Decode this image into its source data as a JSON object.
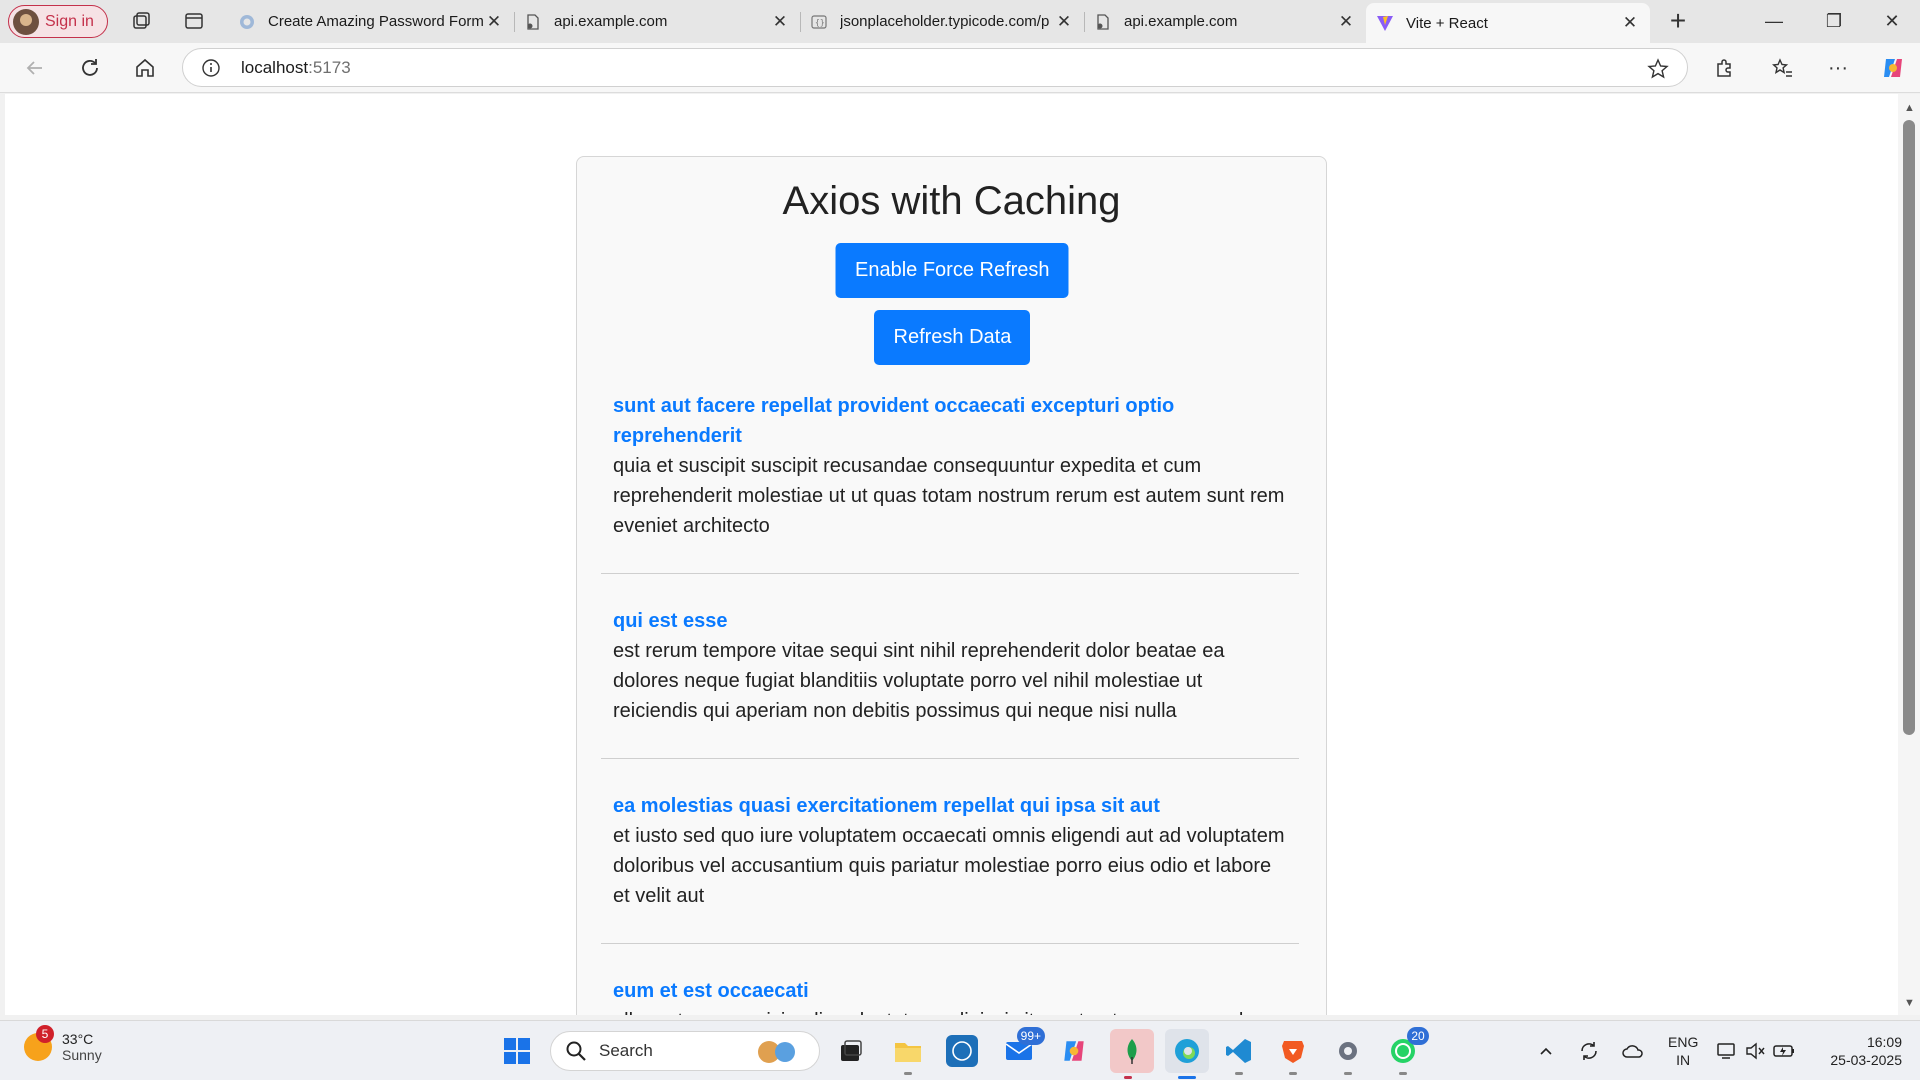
{
  "browser": {
    "signin_label": "Sign in",
    "tabs": [
      {
        "title": "Create Amazing Password Form"
      },
      {
        "title": "api.example.com"
      },
      {
        "title": "jsonplaceholder.typicode.com/p"
      },
      {
        "title": "api.example.com"
      },
      {
        "title": "Vite + React"
      }
    ],
    "address": {
      "host": "localhost",
      "port": ":5173"
    }
  },
  "page": {
    "heading": "Axios with Caching",
    "force_refresh_label": "Enable Force Refresh",
    "refresh_label": "Refresh Data",
    "posts": [
      {
        "title": "sunt aut facere repellat provident occaecati excepturi optio reprehenderit",
        "body": "quia et suscipit suscipit recusandae consequuntur expedita et cum reprehenderit molestiae ut ut quas totam nostrum rerum est autem sunt rem eveniet architecto"
      },
      {
        "title": "qui est esse",
        "body": "est rerum tempore vitae sequi sint nihil reprehenderit dolor beatae ea dolores neque fugiat blanditiis voluptate porro vel nihil molestiae ut reiciendis qui aperiam non debitis possimus qui neque nisi nulla"
      },
      {
        "title": "ea molestias quasi exercitationem repellat qui ipsa sit aut",
        "body": "et iusto sed quo iure voluptatem occaecati omnis eligendi aut ad voluptatem doloribus vel accusantium quis pariatur molestiae porro eius odio et labore et velit aut"
      },
      {
        "title": "eum et est occaecati",
        "body": "ullam et saepe reiciendis voluptatem adipisci sit amet autem assumenda"
      }
    ]
  },
  "taskbar": {
    "weather_badge": "5",
    "temperature": "33°C",
    "condition": "Sunny",
    "search_label": "Search",
    "mail_badge": "99+",
    "whatsapp_badge": "20",
    "lang_top": "ENG",
    "lang_bottom": "IN",
    "time": "16:09",
    "date": "25-03-2025"
  },
  "colors": {
    "accent": "#0a7aff",
    "signin": "#c4314b"
  }
}
